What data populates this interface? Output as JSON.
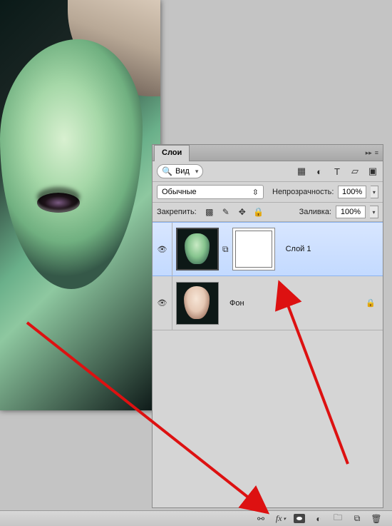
{
  "panel": {
    "tab_label": "Слои",
    "search_kind": "Вид",
    "blend_mode": "Обычные",
    "opacity_label": "Непрозрачность:",
    "opacity_value": "100%",
    "lock_label": "Закрепить:",
    "fill_label": "Заливка:",
    "fill_value": "100%"
  },
  "layers": [
    {
      "name": "Слой 1",
      "selected": true,
      "locked": false,
      "has_mask": true,
      "thumb_variant": "green"
    },
    {
      "name": "Фон",
      "selected": false,
      "locked": true,
      "has_mask": false,
      "thumb_variant": "natural"
    }
  ],
  "icons": {
    "collapse": "▸▸",
    "menu": "≡",
    "search": "🔍",
    "chev": "▾",
    "updown": "⇳",
    "filter_image": "▦",
    "filter_adjust": "◐",
    "filter_text": "T",
    "filter_shape": "▱",
    "filter_smart": "▣",
    "lock_transparent": "▩",
    "lock_paint": "✎",
    "lock_move": "✥",
    "lock_all": "🔒",
    "eye": "👁",
    "link": "⧉",
    "fx": "fx",
    "adjust_circle": "◐",
    "folder": "🗀",
    "newlayer": "⧉",
    "trash": "🗑"
  }
}
